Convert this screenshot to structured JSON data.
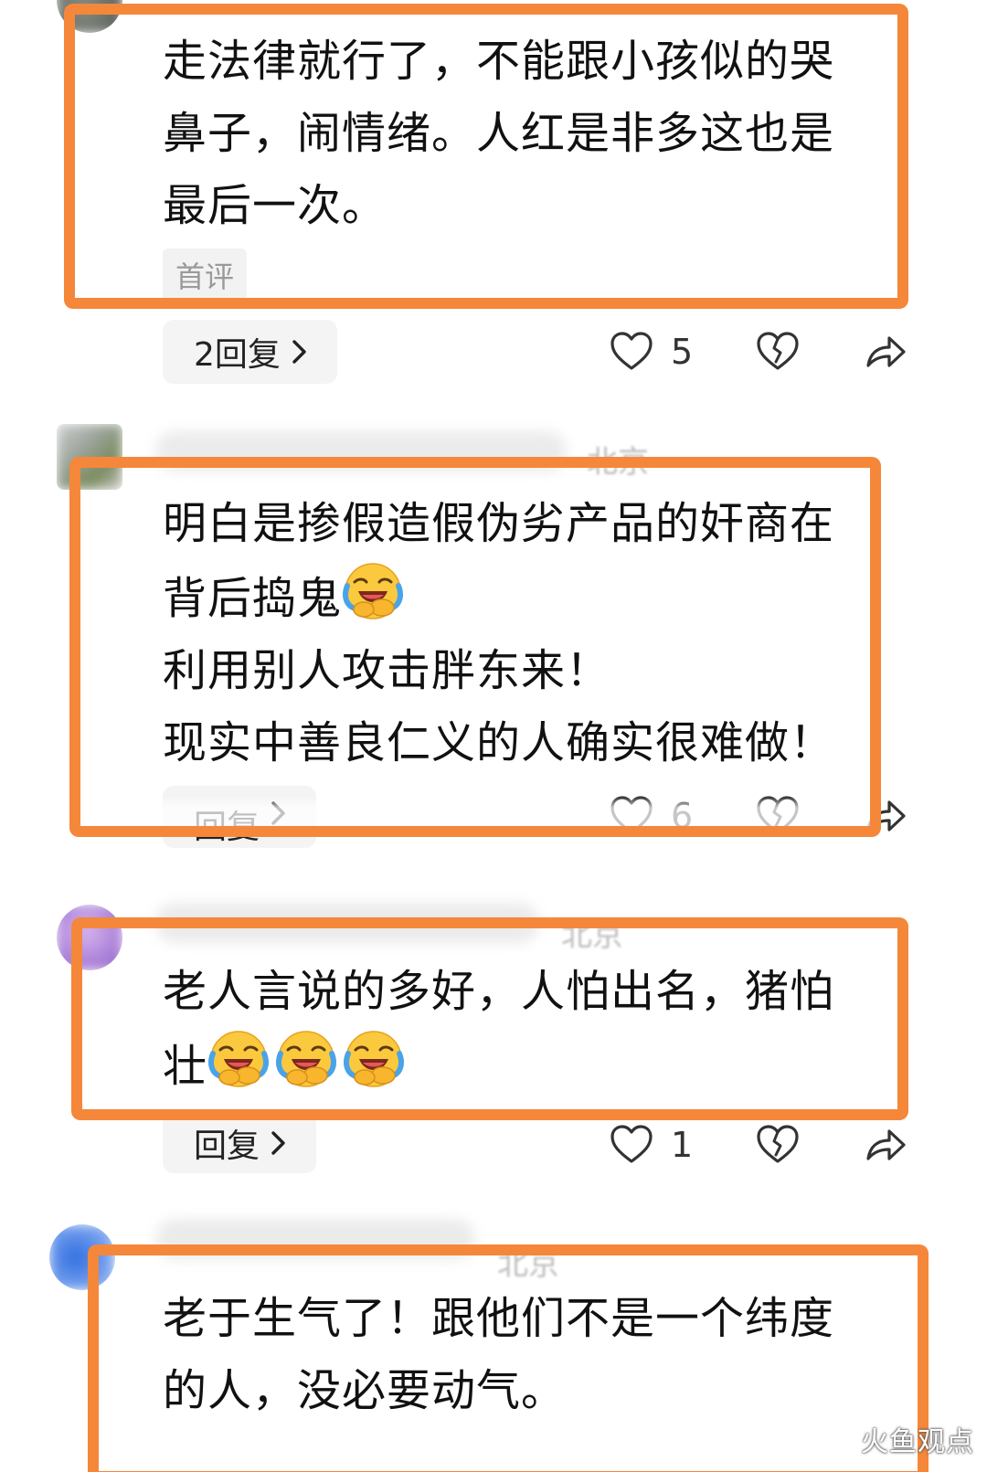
{
  "comments": [
    {
      "location": "",
      "lines": [
        "走法律就行了，不能跟小孩似的哭",
        "鼻子，闹情绪。人红是非多这也是",
        "最后一次。"
      ],
      "tag": "首评",
      "reply_label": "2回复",
      "likes": "5"
    },
    {
      "location": "北京",
      "lines": [
        "明白是掺假造假伪劣产品的奸商在",
        "背后捣鬼",
        "利用别人攻击胖东来！",
        "现实中善良仁义的人确实很难做！"
      ],
      "reply_label": "回复",
      "likes": "6"
    },
    {
      "location": "北京",
      "lines": [
        "老人言说的多好，人怕出名，猪怕",
        "壮"
      ],
      "reply_label": "回复",
      "likes": "1"
    },
    {
      "location": "北京",
      "lines": [
        "老于生气了！跟他们不是一个纬度",
        "的人，没必要动气。"
      ]
    }
  ],
  "icons": {
    "like": "heart-outline-icon",
    "dislike": "broken-heart-icon",
    "share": "share-arrow-icon",
    "emoji": "crying-laughing-emoji-icon"
  },
  "colors": {
    "highlight": "#f5873a",
    "text": "#111111",
    "muted": "#9a9a9a"
  },
  "watermark": "火鱼观点"
}
